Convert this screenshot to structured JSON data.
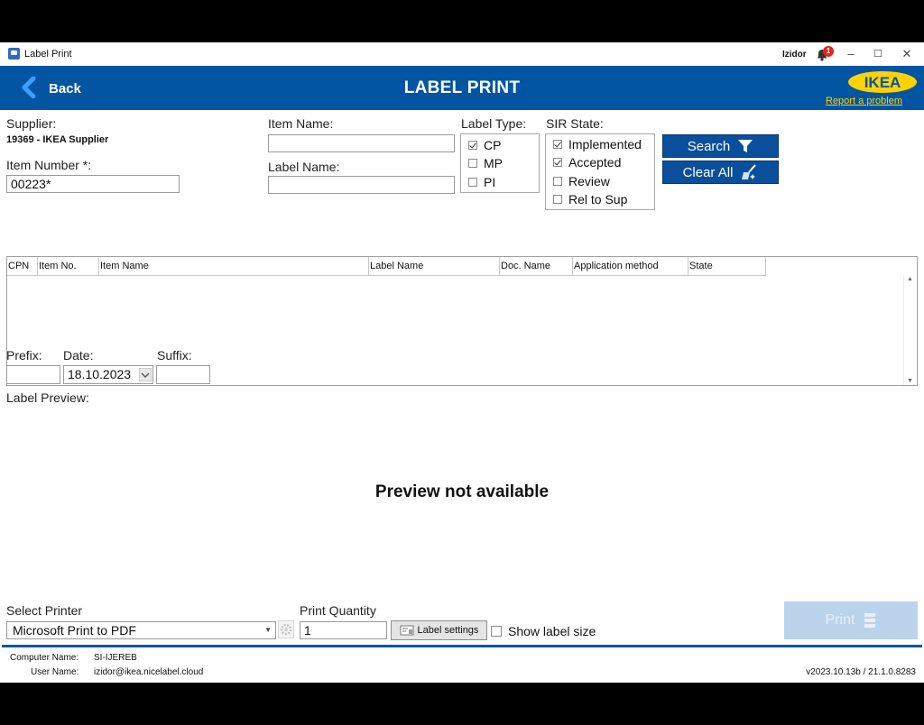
{
  "window": {
    "app_title": "Label Print",
    "user": "Izidor",
    "notifications": "1",
    "minimize_glyph": "–",
    "restore_glyph": "☐",
    "close_glyph": "✕"
  },
  "header": {
    "back_label": "Back",
    "title": "LABEL PRINT",
    "logo_text": "IKEA",
    "report_link": "Report a problem",
    "colors": {
      "bar": "#0255a3",
      "logo_yellow": "#ffd200"
    }
  },
  "search": {
    "supplier_label": "Supplier:",
    "supplier_value": "19369 - IKEA Supplier",
    "item_number_label": "Item Number *:",
    "item_number_value": "00223*",
    "item_name_label": "Item Name:",
    "item_name_value": "",
    "label_name_label": "Label Name:",
    "label_name_value": "",
    "label_type_label": "Label Type:",
    "label_types": [
      {
        "label": "CP",
        "checked": true
      },
      {
        "label": "MP",
        "checked": false
      },
      {
        "label": "PI",
        "checked": false
      }
    ],
    "sir_state_label": "SIR State:",
    "sir_states": [
      {
        "label": "Implemented",
        "checked": true
      },
      {
        "label": "Accepted",
        "checked": true
      },
      {
        "label": "Review",
        "checked": false
      },
      {
        "label": "Rel to Sup",
        "checked": false
      }
    ],
    "search_button": "Search",
    "clear_button": "Clear All"
  },
  "grid": {
    "columns": [
      "CPN",
      "Item No.",
      "Item Name",
      "Label Name",
      "Doc. Name",
      "Application method",
      "State"
    ],
    "rows": []
  },
  "options": {
    "prefix_label": "Prefix:",
    "prefix_value": "",
    "date_label": "Date:",
    "date_value": "18.10.2023",
    "suffix_label": "Suffix:",
    "suffix_value": ""
  },
  "preview": {
    "label": "Label Preview:",
    "message": "Preview not available"
  },
  "printing": {
    "select_printer_label": "Select Printer",
    "printer_value": "Microsoft Print to PDF",
    "quantity_label": "Print Quantity",
    "quantity_value": "1",
    "label_settings_button": "Label settings",
    "show_label_size": "Show label size",
    "show_label_size_checked": false,
    "print_button": "Print"
  },
  "footer": {
    "computer_name_label": "Computer Name:",
    "computer_name": "SI-IJEREB",
    "user_name_label": "User Name:",
    "user_name": "izidor@ikea.nicelabel.cloud",
    "version": "v2023.10.13b / 21.1.0.8283"
  }
}
